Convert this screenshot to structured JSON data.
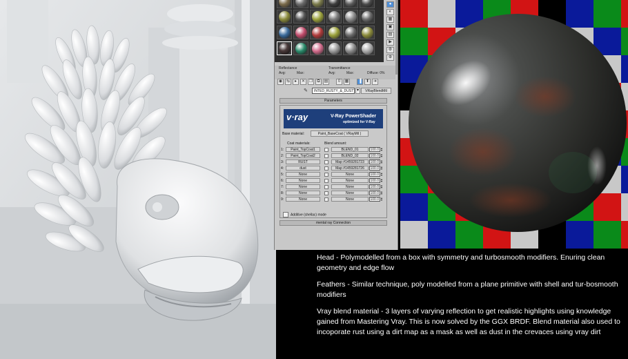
{
  "editor": {
    "reflectance_label": "Reflectance",
    "reflectance_avg": "Avg:",
    "reflectance_max": "Max:",
    "transmittance_label": "Transmittance",
    "transmittance_avg": "Avg:",
    "transmittance_max": "Max:",
    "diffuse_label": "Diffuse: 0%",
    "material_name": "INTED_RUSTY_&_DUSTY",
    "material_type": "VRayBlendMtl",
    "parameters_rollout": "Parameters",
    "banner_logo": "v·ray",
    "banner_title": "V-Ray PowerShader",
    "banner_subtitle": "optimized for V-Ray",
    "base_material_label": "Base material:",
    "base_material_value": "Paint_BaseCoat  ( VRayMtl )",
    "coat_header": "Coat materials:",
    "blend_header": "Blend amount:",
    "coats": [
      {
        "n": "1:",
        "material": "Paint_TopCoat1",
        "blend": "BLEND_01",
        "amount": "100.0"
      },
      {
        "n": "2:",
        "material": "Paint_TopCoat2",
        "blend": "BLEND_02",
        "amount": "100.0"
      },
      {
        "n": "3:",
        "material": "RUST",
        "blend": "Map #1459281723",
        "amount": "100.0"
      },
      {
        "n": "4:",
        "material": "dust",
        "blend": "Map #1459281726",
        "amount": "100.0"
      },
      {
        "n": "5:",
        "material": "None",
        "blend": "None",
        "amount": "100.0"
      },
      {
        "n": "6:",
        "material": "None",
        "blend": "None",
        "amount": "100.0"
      },
      {
        "n": "7:",
        "material": "None",
        "blend": "None",
        "amount": "100.0"
      },
      {
        "n": "8:",
        "material": "None",
        "blend": "None",
        "amount": "100.0"
      },
      {
        "n": "9:",
        "material": "None",
        "blend": "None",
        "amount": "100.0"
      }
    ],
    "additive_label": "Additive (shellac) mode",
    "mr_rollout": "mental ray Connection"
  },
  "description": {
    "p1": "Head - Polymodelled from a box with symmetry and turbosmooth modifiers. Enuring clean geometry and edge flow",
    "p2": "Feathers - Similar technique, poly modelled from a plane primitive with shell and tur-bosmooth modifiers",
    "p3": "Vray blend material - 3 layers of varying reflection to get realistic highlights using knowledge gained from Mastering Vray. This is now solved by the GGX BRDF. Blend material also used to incoporate rust using a dirt map as a mask as well as dust in the crevaces using vray dirt"
  },
  "colors": {
    "slot_balls": [
      "#7a6a4a",
      "#6a6a6a",
      "#7a7a4a",
      "#3d3d3d",
      "#5a5a5a",
      "#4a4a4a",
      "#8a8a3a",
      "#555555",
      "#7a7a7a",
      "#2a7a3a",
      "#3a6a9a",
      "#c04a6a",
      "#b03a3a",
      "#9aa03a",
      "#8a8a8a",
      "#6a6a6a",
      "#3a3a3a",
      "#2a8a6a",
      "#d06a8a",
      "#9a9a9a",
      "#8a8a8a",
      "#aaaaaa"
    ],
    "checker": [
      "#d21414",
      "#0a8a1a",
      "#0a1a9a",
      "#c8c8c8",
      "#000000"
    ]
  }
}
